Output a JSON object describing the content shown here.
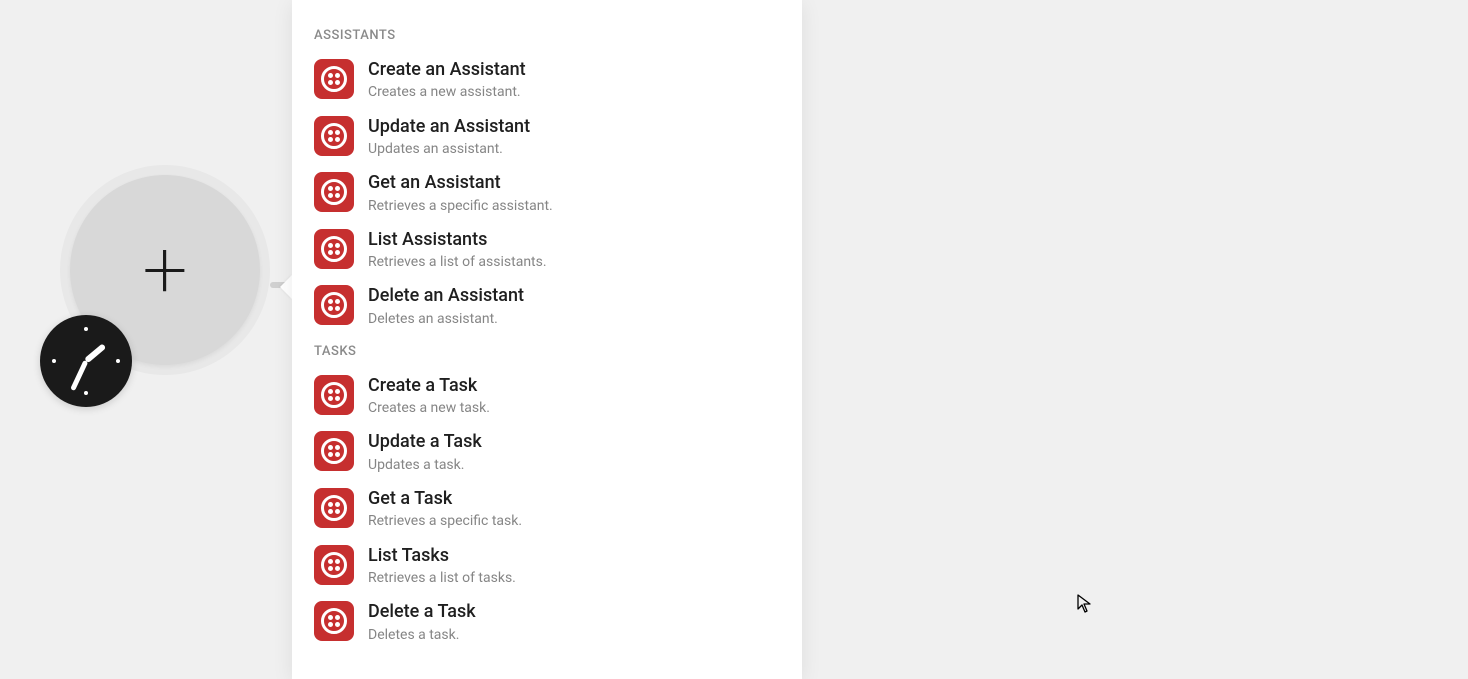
{
  "canvas": {
    "plus_node_label": "Add module",
    "clock_node_label": "Scheduler"
  },
  "menu": {
    "sections": [
      {
        "header": "ASSISTANTS",
        "items": [
          {
            "title": "Create an Assistant",
            "desc": "Creates a new assistant.",
            "icon": "twilio-icon"
          },
          {
            "title": "Update an Assistant",
            "desc": "Updates an assistant.",
            "icon": "twilio-icon"
          },
          {
            "title": "Get an Assistant",
            "desc": "Retrieves a specific assistant.",
            "icon": "twilio-icon"
          },
          {
            "title": "List Assistants",
            "desc": "Retrieves a list of assistants.",
            "icon": "twilio-icon"
          },
          {
            "title": "Delete an Assistant",
            "desc": "Deletes an assistant.",
            "icon": "twilio-icon"
          }
        ]
      },
      {
        "header": "TASKS",
        "items": [
          {
            "title": "Create a Task",
            "desc": "Creates a new task.",
            "icon": "twilio-icon"
          },
          {
            "title": "Update a Task",
            "desc": "Updates a task.",
            "icon": "twilio-icon"
          },
          {
            "title": "Get a Task",
            "desc": "Retrieves a specific task.",
            "icon": "twilio-icon"
          },
          {
            "title": "List Tasks",
            "desc": "Retrieves a list of tasks.",
            "icon": "twilio-icon"
          },
          {
            "title": "Delete a Task",
            "desc": "Deletes a task.",
            "icon": "twilio-icon"
          }
        ]
      }
    ]
  },
  "colors": {
    "icon_bg": "#c62f2f",
    "panel_bg": "#ffffff",
    "canvas_bg": "#f0f0f0"
  }
}
